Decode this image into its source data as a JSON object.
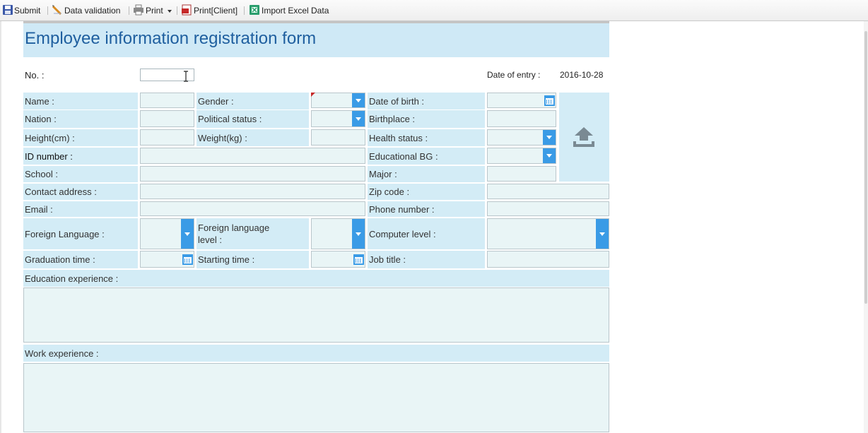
{
  "toolbar": {
    "submit": "Submit",
    "validate": "Data validation",
    "print": "Print",
    "print_client": "Print[Client]",
    "import": "Import Excel Data"
  },
  "form": {
    "title": "Employee information registration form",
    "no_label": "No. :",
    "date_label": "Date of entry :",
    "date_value": "2016-10-28",
    "labels": {
      "name": "Name :",
      "gender": "Gender :",
      "dob": "Date of birth :",
      "nation": "Nation :",
      "political": "Political status :",
      "birthplace": "Birthplace :",
      "height": "Height(cm) :",
      "weight": "Weight(kg) :",
      "health": "Health status :",
      "id": "ID number :",
      "education": "Educational BG :",
      "school": "School :",
      "major": "Major :",
      "address": "Contact address :",
      "zip": "Zip code :",
      "email": "Email :",
      "phone": "Phone number :",
      "foreign": "Foreign Language :",
      "foreign_level": "Foreign language level :",
      "computer": "Computer level :",
      "graduation": "Graduation time :",
      "starting": "Starting time :",
      "job": "Job title :",
      "edu_exp": "Education experience :",
      "work_exp": "Work experience :"
    }
  },
  "colors": {
    "label_bg": "#d3ecf6",
    "field_bg": "#e9f5f6",
    "accent": "#3a9be6",
    "title": "#1f5f9f"
  },
  "icons": [
    "save-icon",
    "pencil-icon",
    "printer-icon",
    "pdf-icon",
    "excel-icon",
    "upload-icon",
    "calendar-icon",
    "chevron-down-icon"
  ]
}
